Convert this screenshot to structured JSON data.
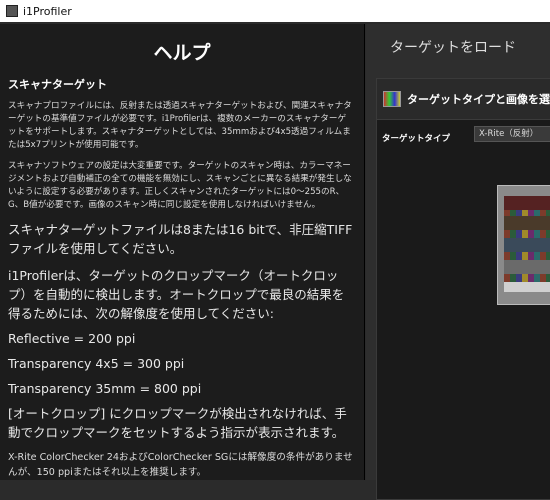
{
  "window": {
    "title": "i1Profiler"
  },
  "help": {
    "heading": "ヘルプ",
    "subheading": "スキャナターゲット",
    "para1": "スキャナプロファイルには、反射または透過スキャナターゲットおよび、関連スキャナターゲットの基準値ファイルが必要です。i1Profilerは、複数のメーカーのスキャナターゲットをサポートします。スキャナターゲットとしては、35mmおよび4x5透過フィルムまたは5x7プリントが使用可能です。",
    "para2": "スキャナソフトウェアの設定は大変重要です。ターゲットのスキャン時は、カラーマネージメントおよび自動補正の全ての機能を無効にし、スキャンごとに異なる結果が発生しないように設定する必要があります。正しくスキャンされたターゲットには0〜255のR、G、B値が必要です。画像のスキャン時に同じ設定を使用しなければいけません。",
    "para3": "スキャナターゲットファイルは8または16 bitで、非圧縮TIFFファイルを使用してください。",
    "para4": "i1Profilerは、ターゲットのクロップマーク（オートクロップ）を自動的に検出します。オートクロップで最良の結果を得るためには、次の解像度を使用してください:",
    "res1": "Reflective = 200 ppi",
    "res2": "Transparency 4x5 = 300 ppi",
    "res3": "Transparency 35mm = 800 ppi",
    "para5": "[オートクロップ] にクロップマークが検出されなければ、手動でクロップマークをセットするよう指示が表示されます。",
    "para6": "X-Rite ColorChecker 24およびColorChecker SGには解像度の条件がありませんが、150 ppiまたはそれ以上を推奨します。"
  },
  "right": {
    "title": "ターゲットをロード",
    "card_header": "ターゲットタイプと画像を選択",
    "type_label": "ターゲットタイプ",
    "type_value": "X-Rite（反射）"
  },
  "icons": {
    "app": "app-icon",
    "collapse": "collapse-left-arrow-icon",
    "target": "target-image-icon"
  }
}
